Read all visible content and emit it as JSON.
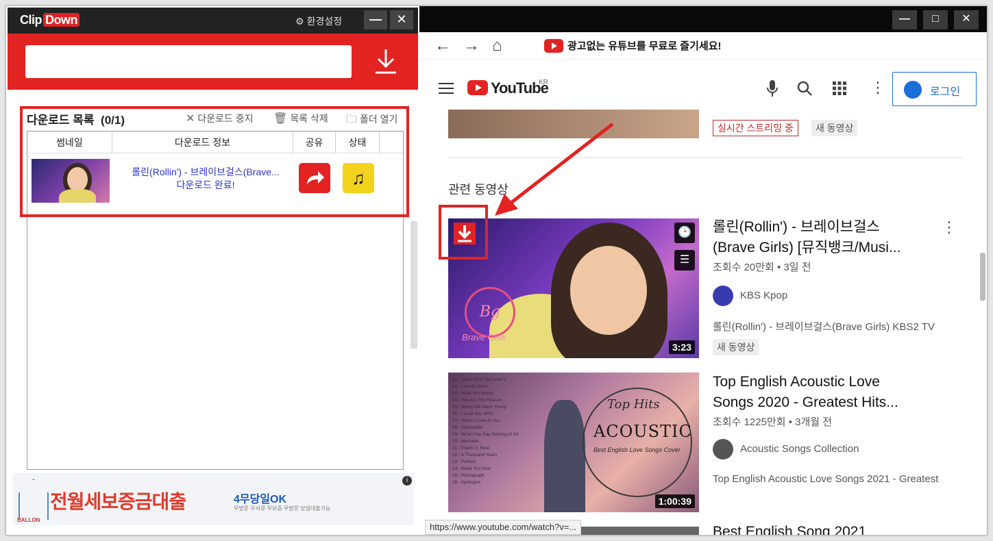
{
  "clipdown": {
    "logo": "Clip",
    "logo_accent": "Down",
    "settings_label": "환경설정",
    "minimize": "—",
    "close": "✕",
    "url_value": "",
    "list": {
      "title": "다운로드 목록",
      "count": "(0/1)",
      "actions": {
        "stop": "다운로드 중지",
        "delete": "목록 삭제",
        "open_folder": "폴더 열기"
      },
      "columns": [
        "썸네일",
        "다운로드 정보",
        "공유",
        "상태"
      ],
      "item": {
        "title": "롤린(Rollin') - 브레이브걸스(Brave...",
        "status": "다운로드 완료!"
      }
    },
    "ad": {
      "headline": "전월세보증금대출",
      "tagline": "4무당일OK",
      "small": "무방문 무서류 무보증 무방문 당일대출가능",
      "brand": "DALLON",
      "info": "i"
    }
  },
  "browser": {
    "promo_text": "광고없는 유튜브를 무료로 즐기세요!",
    "youtube_word": "YouTube",
    "region": "KR",
    "login_label": "로그인",
    "prev_tags": {
      "live": "실시간 스트리밍 중",
      "new": "새 동영상"
    },
    "related_label": "관련 동영상",
    "videos": [
      {
        "title_line1": "롤린(Rollin') - 브레이브걸스",
        "title_line2": "(Brave Girls) [뮤직뱅크/Musi...",
        "meta": "조회수 20만회 • 3일 전",
        "channel": "KBS Kpop",
        "desc": "롤린(Rollin') - 브레이브걸스(Brave Girls) KBS2 TV",
        "badge": "새 동영상",
        "duration": "3:23",
        "thumb_logo": "Bg",
        "thumb_text": "Brave Girls"
      },
      {
        "title_line1": "Top English Acoustic Love",
        "title_line2": "Songs 2020 - Greatest Hits...",
        "meta": "조회수 1225만회 • 3개월 전",
        "channel": "Acoustic Songs Collection",
        "desc": "Top English Acoustic Love Songs 2021 - Greatest",
        "duration": "1:00:39",
        "thumb_top": "Top Hits",
        "thumb_acoustic": "ACOUSTIC",
        "thumb_sub": "Best English Love Songs Cover",
        "thumb_list": "01 - Some One You Love 0\n02 - Love Is Gone\n03 - What Are Words\n04 - You Are The Reason\n05 - When We Were Young\n06 - I Love You 3000\n07 - When I Look At You\n08 - Impossible\n09 - When You Say Nothing At All\n10 - Memorie\n11 - Thank U, Next\n12 - A Thousand Years\n13 - Perfect\n14 - Need You Now\n15 - Photograph\n16 - Apologize"
      },
      {
        "title_line1": "Best English Song 2021"
      }
    ],
    "status_url": "https://www.youtube.com/watch?v=..."
  },
  "colors": {
    "accent_red": "#e32222",
    "link_blue": "#2a34c8",
    "yt_blue": "#1a6ed8",
    "music_yellow": "#f3d21b"
  }
}
